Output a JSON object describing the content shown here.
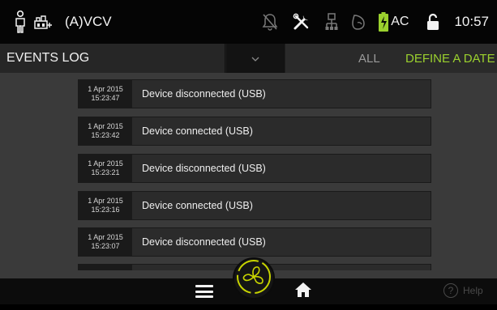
{
  "status": {
    "mode": "(A)VCV",
    "power_label": "AC",
    "time": "10:57",
    "icons": [
      "patient-icon",
      "ventilator-icon",
      "alarm-silenced-icon",
      "tools-icon",
      "network-icon",
      "mask-icon",
      "battery-charging-icon",
      "lock-open-icon"
    ]
  },
  "header": {
    "title": "EVENTS LOG",
    "filter_all": "ALL",
    "filter_date": "DEFINE A DATE"
  },
  "events": [
    {
      "date": "1 Apr 2015",
      "time": "15:23:47",
      "message": "Device disconnected (USB)"
    },
    {
      "date": "1 Apr 2015",
      "time": "15:23:42",
      "message": "Device connected (USB)"
    },
    {
      "date": "1 Apr 2015",
      "time": "15:23:21",
      "message": "Device disconnected (USB)"
    },
    {
      "date": "1 Apr 2015",
      "time": "15:23:16",
      "message": "Device connected (USB)"
    },
    {
      "date": "1 Apr 2015",
      "time": "15:23:07",
      "message": "Device disconnected (USB)"
    }
  ],
  "footer": {
    "help_label": "Help"
  },
  "colors": {
    "accent": "#9bd12e",
    "fan_ring": "#c8d400"
  }
}
